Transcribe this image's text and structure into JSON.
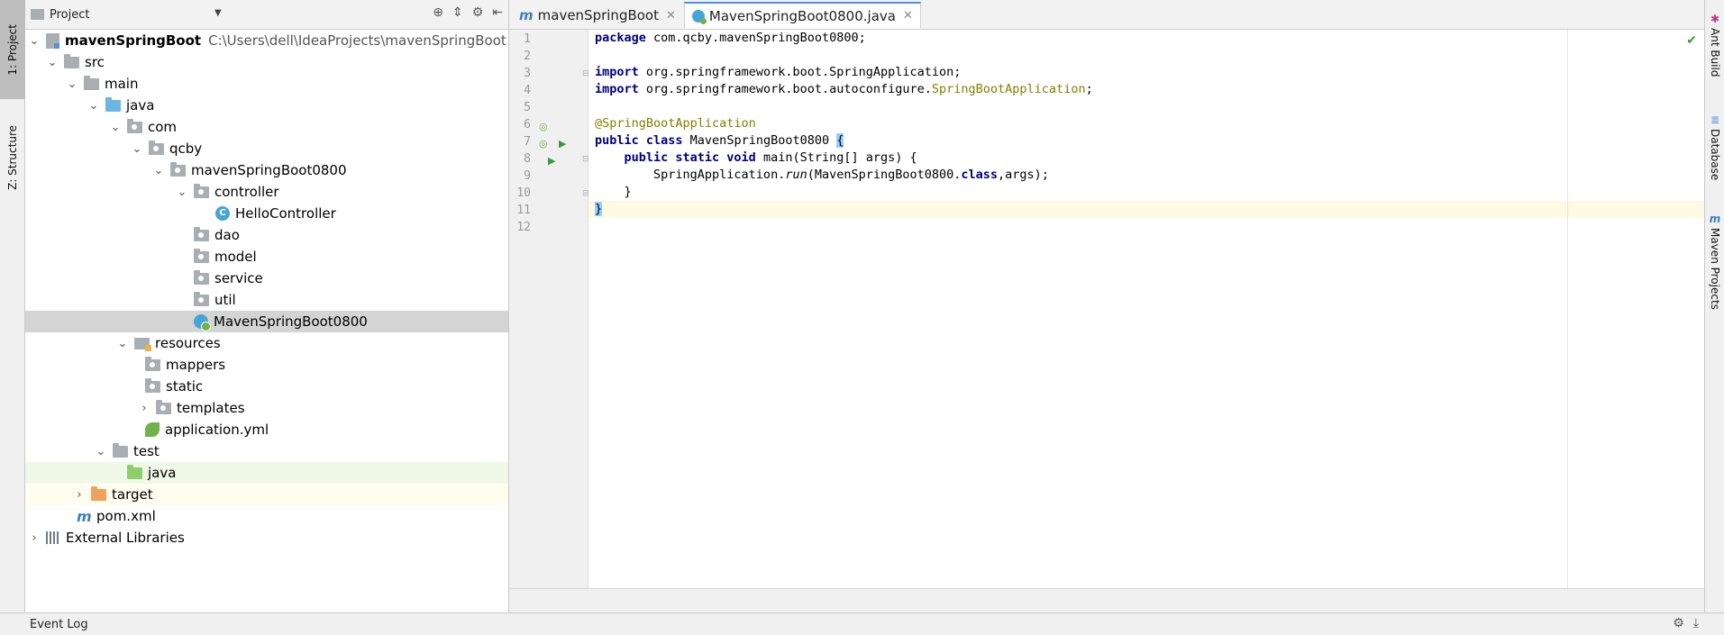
{
  "left_tabs": [
    {
      "label": "1: Project",
      "active": true
    },
    {
      "label": "Z: Structure",
      "active": false
    }
  ],
  "right_tabs": [
    {
      "label": "Ant Build"
    },
    {
      "label": "Database"
    },
    {
      "label": "Maven Projects"
    }
  ],
  "project_panel": {
    "title": "Project"
  },
  "tree": {
    "root_name": "mavenSpringBoot",
    "root_path": "C:\\Users\\dell\\IdeaProjects\\mavenSpringBoot",
    "src": "src",
    "main": "main",
    "java": "java",
    "com": "com",
    "qcby": "qcby",
    "pkg": "mavenSpringBoot0800",
    "controller": "controller",
    "hello_controller": "HelloController",
    "dao": "dao",
    "model": "model",
    "service": "service",
    "util": "util",
    "main_class": "MavenSpringBoot0800",
    "resources": "resources",
    "mappers": "mappers",
    "static": "static",
    "templates": "templates",
    "application_yml": "application.yml",
    "test": "test",
    "test_java": "java",
    "target": "target",
    "pom": "pom.xml",
    "external_libraries": "External Libraries"
  },
  "editor": {
    "tabs": [
      {
        "label": "mavenSpringBoot",
        "active": false
      },
      {
        "label": "MavenSpringBoot0800.java",
        "active": true
      }
    ],
    "line_numbers": [
      "1",
      "2",
      "3",
      "4",
      "5",
      "6",
      "7",
      "8",
      "9",
      "10",
      "11",
      "12"
    ],
    "code": {
      "l1_kw": "package",
      "l1_rest": " com.qcby.mavenSpringBoot0800;",
      "l3_kw": "import",
      "l3_rest": " org.springframework.boot.SpringApplication;",
      "l4_kw": "import",
      "l4_rest": " org.springframework.boot.autoconfigure.",
      "l4_ann": "SpringBootApplication",
      "l4_end": ";",
      "l6_ann": "@SpringBootApplication",
      "l7_kw": "public class",
      "l7_rest": " MavenSpringBoot0800 ",
      "l7_brace": "{",
      "l8_indent": "    ",
      "l8_kw": "public static void",
      "l8_rest": " main(String[] args) {",
      "l9_indent": "        SpringApplication.",
      "l9_it": "run",
      "l9_mid": "(MavenSpringBoot0800.",
      "l9_kw": "class",
      "l9_end": ",args);",
      "l10": "    }",
      "l11_brace": "}"
    }
  },
  "statusbar": {
    "event_log": "Event Log"
  }
}
